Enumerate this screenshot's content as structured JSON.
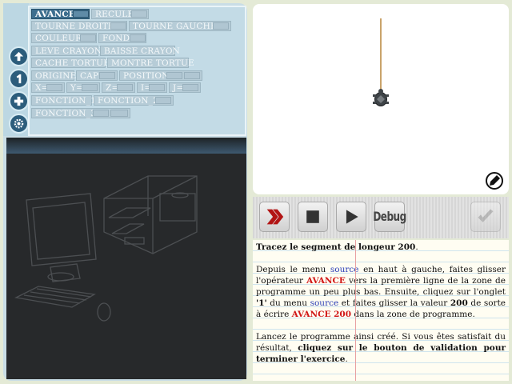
{
  "blocks": {
    "avance": "AVANCE",
    "recule": "RECULE",
    "tourne_droite": "TOURNE DROITE",
    "tourne_gauche": "TOURNE GAUCHE",
    "couleur": "COULEUR",
    "fond": "FOND",
    "leve_crayon": "LEVE CRAYON",
    "baisse_crayon": "BAISSE CRAYON",
    "cache_tortue": "CACHE TORTUE",
    "montre_tortue": "MONTRE TORTUE",
    "origine": "ORIGINE",
    "cap": "CAP",
    "position": "POSITION",
    "x": "X=",
    "y": "Y=",
    "z": "Z=",
    "i": "I=",
    "j": "J=",
    "fonction_1": "FONCTION_1",
    "fonction_2": "FONCTION_2",
    "fonction_3": "FONCTION_3"
  },
  "toolbar": {
    "run_icon": "double-chevron-right-icon",
    "stop_icon": "stop-square-icon",
    "play_icon": "play-triangle-icon",
    "debug_label": "Debug",
    "validate_icon": "checkmark-icon"
  },
  "instructions": {
    "title": "Tracez le segment de longeur 200",
    "title_end": ".",
    "p1_a": "Depuis le menu ",
    "p1_source": "source",
    "p1_b": " en haut à gauche, faites glisser l'opérateur ",
    "p1_avance": "AVANCE",
    "p1_c": " vers la première ligne de la zone de programme un peu plus bas. Ensuite, cliquez sur l'onglet ",
    "p1_tab": "'1'",
    "p1_d": " du menu ",
    "p1_source2": "source",
    "p1_e": " et faites glisser la valeur ",
    "p1_value": "200",
    "p1_f": " de sorte à écrire ",
    "p1_code": "AVANCE 200",
    "p1_g": " dans la zone de programme.",
    "p2_a": "Lancez le programme ainsi créé. Si vous êtes satisfait du résultat, ",
    "p2_bold": "cliquez sur le bouton de validation pour terminer l'exercice",
    "p2_end": "."
  },
  "colors": {
    "accent_red": "#d11818",
    "link_blue": "#2a3db6",
    "tab_blue": "#2c5d7c",
    "trace": "#c9a36a"
  }
}
